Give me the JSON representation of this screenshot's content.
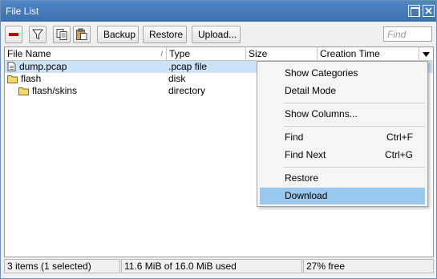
{
  "window": {
    "title": "File List",
    "maximize_icon": "maximize-icon",
    "close_icon": "close-icon"
  },
  "toolbar": {
    "remove_icon": "minus-icon",
    "filter_icon": "funnel-icon",
    "copy_icon": "copy-icon",
    "paste_icon": "clipboard-icon",
    "backup_label": "Backup",
    "restore_label": "Restore",
    "upload_label": "Upload...",
    "find_placeholder": "Find",
    "find_value": ""
  },
  "table": {
    "columns": [
      "File Name",
      "Type",
      "Size",
      "Creation Time"
    ],
    "sort_indicator": "/",
    "rows": [
      {
        "name": "dump.pcap",
        "type": ".pcap file",
        "icon": "file-icon",
        "selected": true
      },
      {
        "name": "flash",
        "type": "disk",
        "icon": "folder-icon",
        "selected": false
      },
      {
        "name": "flash/skins",
        "type": "directory",
        "icon": "folder-icon",
        "selected": false
      }
    ]
  },
  "context_menu": {
    "items": [
      {
        "label": "Show Categories",
        "shortcut": ""
      },
      {
        "label": "Detail Mode",
        "shortcut": ""
      },
      {
        "label": "Show Columns...",
        "shortcut": ""
      },
      {
        "label": "Find",
        "shortcut": "Ctrl+F"
      },
      {
        "label": "Find Next",
        "shortcut": "Ctrl+G"
      },
      {
        "label": "Restore",
        "shortcut": ""
      },
      {
        "label": "Download",
        "shortcut": "",
        "highlighted": true
      }
    ]
  },
  "status": {
    "items_count": "3 items (1 selected)",
    "usage": "11.6 MiB of 16.0 MiB used",
    "free": "27% free"
  },
  "colors": {
    "titlebar": "#3b70b1",
    "selected_row": "#cce3f7",
    "menu_highlight": "#99c9ef",
    "remove_red": "#c00000",
    "folder_yellow": "#f5d76e"
  }
}
